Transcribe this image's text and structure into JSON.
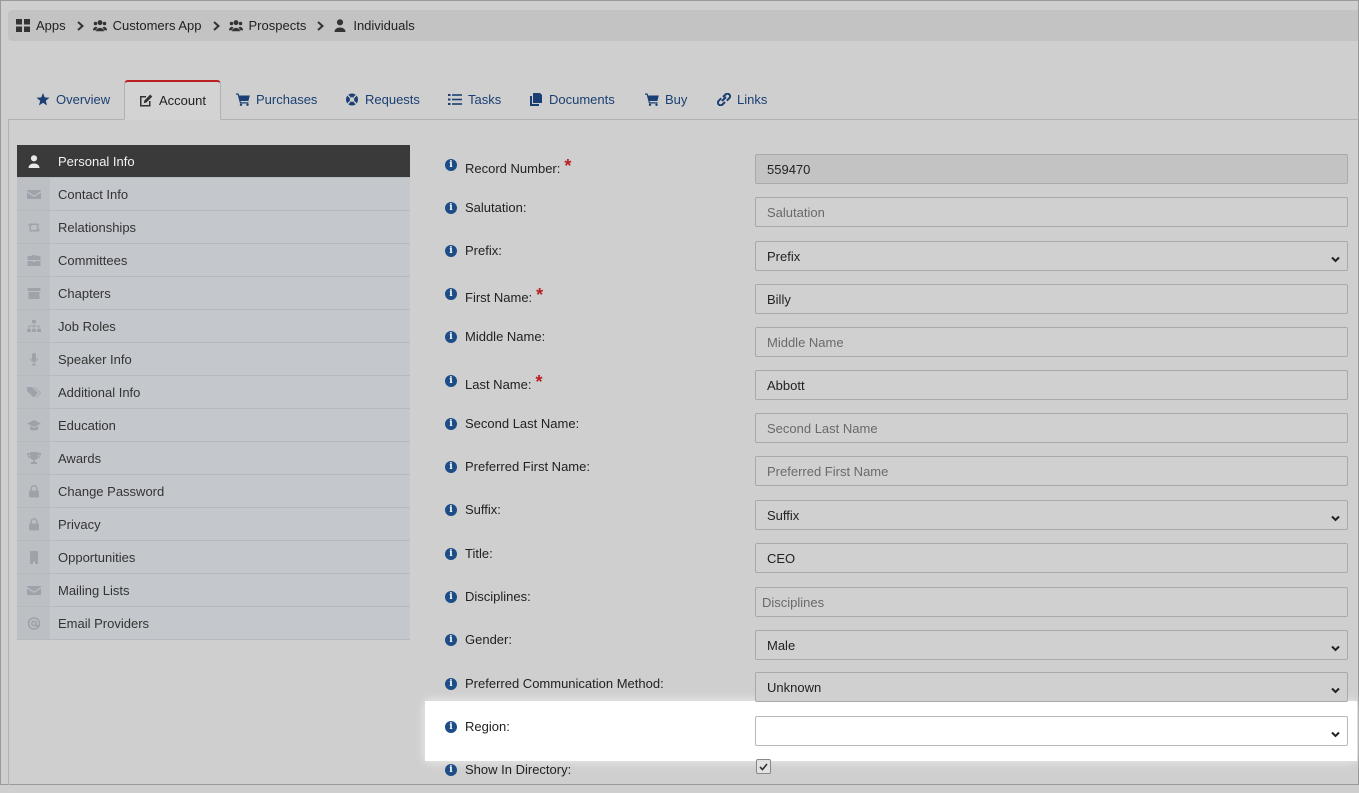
{
  "breadcrumb": {
    "items": [
      {
        "label": "Apps",
        "icon": "grid-icon"
      },
      {
        "label": "Customers App",
        "icon": "users-icon"
      },
      {
        "label": "Prospects",
        "icon": "users-icon"
      },
      {
        "label": "Individuals",
        "icon": "user-icon"
      }
    ]
  },
  "tabs": [
    {
      "label": "Overview",
      "icon": "star-icon"
    },
    {
      "label": "Account",
      "icon": "edit-icon",
      "active": true
    },
    {
      "label": "Purchases",
      "icon": "cart-icon"
    },
    {
      "label": "Requests",
      "icon": "lifebuoy-icon"
    },
    {
      "label": "Tasks",
      "icon": "tasks-icon"
    },
    {
      "label": "Documents",
      "icon": "documents-icon"
    },
    {
      "label": "Buy",
      "icon": "cart-icon"
    },
    {
      "label": "Links",
      "icon": "link-icon"
    }
  ],
  "sidebar": {
    "items": [
      {
        "label": "Personal Info",
        "icon": "user-icon",
        "active": true
      },
      {
        "label": "Contact Info",
        "icon": "envelope-icon"
      },
      {
        "label": "Relationships",
        "icon": "retweet-icon"
      },
      {
        "label": "Committees",
        "icon": "briefcase-icon"
      },
      {
        "label": "Chapters",
        "icon": "archive-icon"
      },
      {
        "label": "Job Roles",
        "icon": "sitemap-icon"
      },
      {
        "label": "Speaker Info",
        "icon": "microphone-icon"
      },
      {
        "label": "Additional Info",
        "icon": "tags-icon"
      },
      {
        "label": "Education",
        "icon": "graduation-cap-icon"
      },
      {
        "label": "Awards",
        "icon": "trophy-icon"
      },
      {
        "label": "Change Password",
        "icon": "lock-icon"
      },
      {
        "label": "Privacy",
        "icon": "lock-icon"
      },
      {
        "label": "Opportunities",
        "icon": "building-icon"
      },
      {
        "label": "Mailing Lists",
        "icon": "envelope-icon"
      },
      {
        "label": "Email Providers",
        "icon": "at-icon"
      }
    ]
  },
  "form": {
    "fields": [
      {
        "label": "Record Number:",
        "required": true,
        "type": "text",
        "value": "559470",
        "readonly": true
      },
      {
        "label": "Salutation:",
        "type": "text",
        "value": "",
        "placeholder": "Salutation"
      },
      {
        "label": "Prefix:",
        "type": "select",
        "value": "Prefix"
      },
      {
        "label": "First Name:",
        "required": true,
        "type": "text",
        "value": "Billy"
      },
      {
        "label": "Middle Name:",
        "type": "text",
        "value": "",
        "placeholder": "Middle Name"
      },
      {
        "label": "Last Name:",
        "required": true,
        "type": "text",
        "value": "Abbott"
      },
      {
        "label": "Second Last Name:",
        "type": "text",
        "value": "",
        "placeholder": "Second Last Name"
      },
      {
        "label": "Preferred First Name:",
        "type": "text",
        "value": "",
        "placeholder": "Preferred First Name"
      },
      {
        "label": "Suffix:",
        "type": "select",
        "value": "Suffix"
      },
      {
        "label": "Title:",
        "type": "text",
        "value": "CEO"
      },
      {
        "label": "Disciplines:",
        "type": "text",
        "value": "",
        "placeholder": "Disciplines"
      },
      {
        "label": "Gender:",
        "type": "select",
        "value": "Male"
      },
      {
        "label": "Preferred Communication Method:",
        "type": "select",
        "value": "Unknown"
      },
      {
        "label": "Region:",
        "type": "select",
        "value": "",
        "highlighted": true
      },
      {
        "label": "Show In Directory:",
        "type": "checkbox",
        "checked": true
      }
    ]
  },
  "colors": {
    "accent": "#1b3f72",
    "required": "#b81f1f",
    "active_sidebar": "#3a3a3a"
  }
}
